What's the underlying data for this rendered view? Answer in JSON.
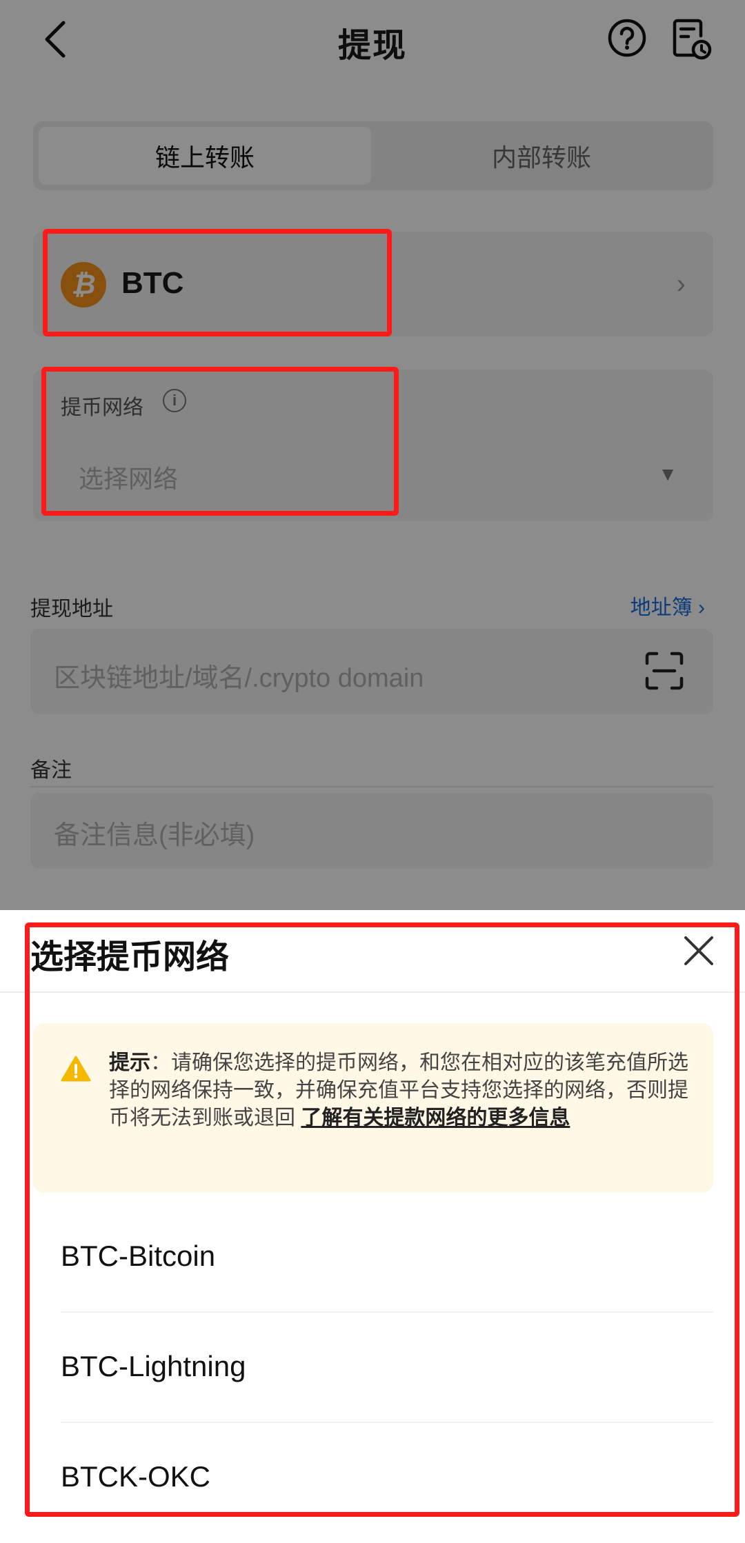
{
  "header": {
    "title": "提现",
    "back_icon": "chevron-left-icon",
    "help_icon": "help-circle-icon",
    "history_icon": "record-clock-icon"
  },
  "tabs": [
    {
      "label": "链上转账",
      "active": true
    },
    {
      "label": "内部转账",
      "active": false
    }
  ],
  "coin": {
    "name": "BTC",
    "icon": "bitcoin-icon",
    "icon_glyph": "₿",
    "brand_color": "#f7931a"
  },
  "network": {
    "label": "提币网络",
    "placeholder": "选择网络"
  },
  "address": {
    "label": "提现地址",
    "book_link": "地址簿 ›",
    "placeholder": "区块链地址/域名/.crypto domain"
  },
  "memo": {
    "label": "备注",
    "placeholder": "备注信息(非必填)"
  },
  "sheet": {
    "title": "选择提币网络",
    "notice_title": "提示",
    "notice_body": "：请确保您选择的提币网络，和您在相对应的该笔充值所选择的网络保持一致，并确保充值平台支持您选择的网络，否则提币将无法到账或退回 ",
    "notice_link": "了解有关提款网络的更多信息",
    "options": [
      "BTC-Bitcoin",
      "BTC-Lightning",
      "BTCK-OKC"
    ]
  },
  "colors": {
    "annotation_red": "#ff1a1a",
    "link_blue": "#1a6de0",
    "notice_bg": "#fff8e6",
    "warning_yellow": "#f5b800"
  }
}
